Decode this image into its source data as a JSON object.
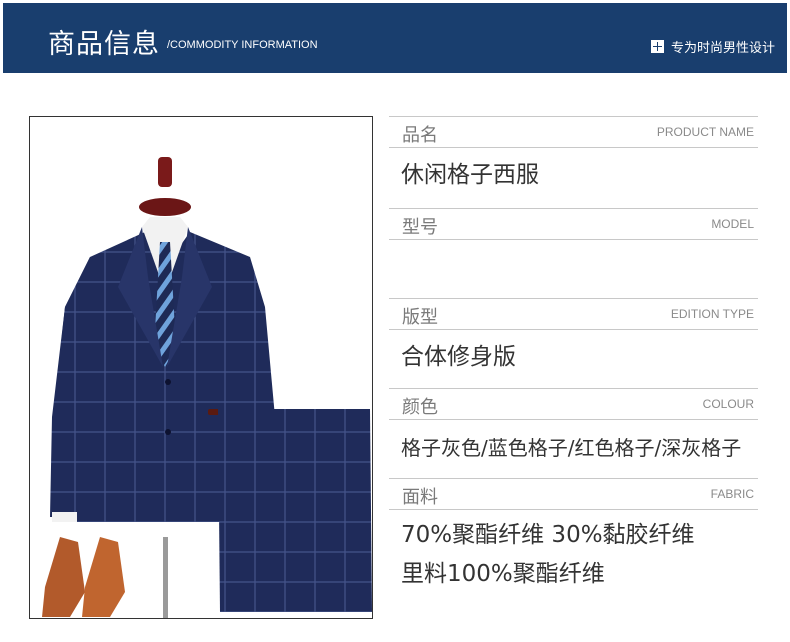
{
  "header": {
    "title": "商品信息",
    "subtitle": "/COMMODITY INFORMATION",
    "tagline": "专为时尚男性设计"
  },
  "colors": {
    "banner": "#193e6e",
    "suit_navy": "#1f2b5a",
    "label_text": "#7a7a7a",
    "value_text": "#333333"
  },
  "fields": [
    {
      "label": "品名",
      "label_en": "PRODUCT NAME",
      "values": [
        "休闲格子西服"
      ]
    },
    {
      "label": "型号",
      "label_en": "MODEL",
      "values": []
    },
    {
      "label": "版型",
      "label_en": "EDITION TYPE",
      "values": [
        "合体修身版"
      ]
    },
    {
      "label": "颜色",
      "label_en": "COLOUR",
      "values": [
        "格子灰色/蓝色格子/红色格子/深灰格子"
      ]
    },
    {
      "label": "面料",
      "label_en": "FABRIC",
      "values": [
        "70%聚酯纤维 30%黏胶纤维",
        "里料100%聚酯纤维"
      ]
    }
  ]
}
